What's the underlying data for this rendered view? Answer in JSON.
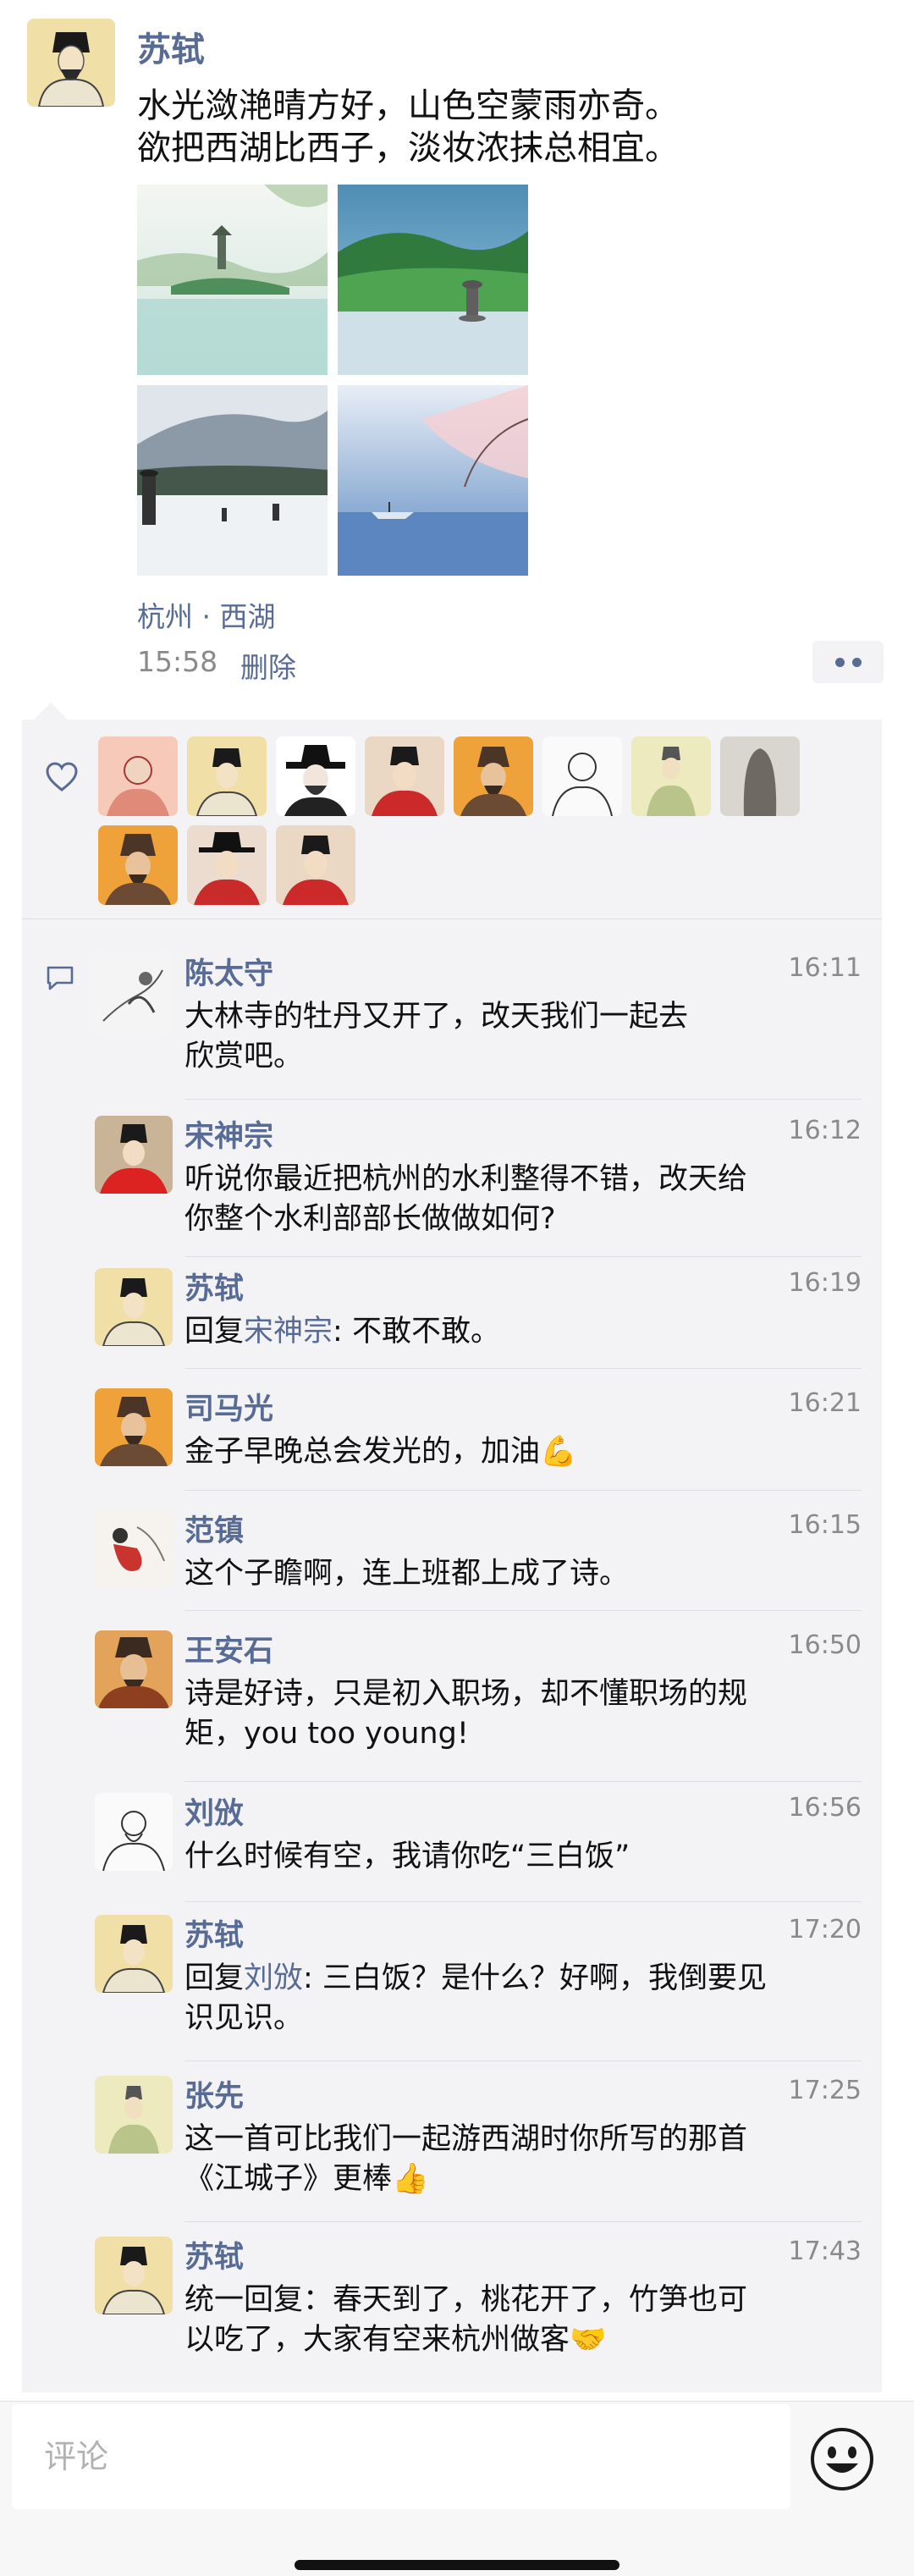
{
  "post": {
    "author": "苏轼",
    "text_lines": [
      "水光潋滟晴方好，山色空蒙雨亦奇。",
      "欲把西湖比西子，淡妆浓抹总相宜。"
    ],
    "location": "杭州 · 西湖",
    "time": "15:58",
    "delete_label": "删除",
    "photos": [
      "painted-lake-pagoda",
      "stone-pagoda-green-hills",
      "lake-pagodas-mountains",
      "cherry-blossom-boat"
    ]
  },
  "likes": {
    "icon": "heart-outline-icon",
    "avatars": [
      "portrait-red",
      "portrait-sushi-1",
      "portrait-black-hat",
      "portrait-red-robe",
      "portrait-orange",
      "portrait-sketch",
      "portrait-green",
      "portrait-dark-statue",
      "portrait-hat-orange",
      "portrait-red-robe-2",
      "portrait-red-robe-3"
    ]
  },
  "comments_icon": "comment-bubble-icon",
  "comments": [
    {
      "name": "陈太守",
      "time": "16:11",
      "lines": [
        "大林寺的牡丹又开了，改天我们一起去",
        "欣赏吧。"
      ]
    },
    {
      "name": "宋神宗",
      "time": "16:12",
      "lines": [
        "听说你最近把杭州的水利整得不错，改天给",
        "你整个水利部部长做做如何?"
      ]
    },
    {
      "name": "苏轼",
      "time": "16:19",
      "reply_prefix": "回复",
      "reply_to": "宋神宗",
      "lines": [
        ": 不敢不敢。"
      ]
    },
    {
      "name": "司马光",
      "time": "16:21",
      "lines": [
        "金子早晚总会发光的，加油💪"
      ]
    },
    {
      "name": "范镇",
      "time": "16:15",
      "lines": [
        "这个子瞻啊，连上班都上成了诗。"
      ]
    },
    {
      "name": "王安石",
      "time": "16:50",
      "lines": [
        "诗是好诗，只是初入职场，却不懂职场的规",
        "矩，you too young!"
      ]
    },
    {
      "name": "刘攽",
      "time": "16:56",
      "lines": [
        "什么时候有空，我请你吃“三白饭”"
      ]
    },
    {
      "name": "苏轼",
      "time": "17:20",
      "reply_prefix": "回复",
      "reply_to": "刘攽",
      "lines": [
        ": 三白饭？是什么？好啊，我倒要见",
        "识见识。"
      ]
    },
    {
      "name": "张先",
      "time": "17:25",
      "lines": [
        "这一首可比我们一起游西湖时你所写的那首",
        "《江城子》更棒👍"
      ]
    },
    {
      "name": "苏轼",
      "time": "17:43",
      "lines": [
        "统一回复：春天到了，桃花开了，竹笋也可",
        "以吃了，大家有空来杭州做客🤝"
      ]
    }
  ],
  "input": {
    "placeholder": "评论",
    "emoji_icon": "emoji-face-icon"
  }
}
